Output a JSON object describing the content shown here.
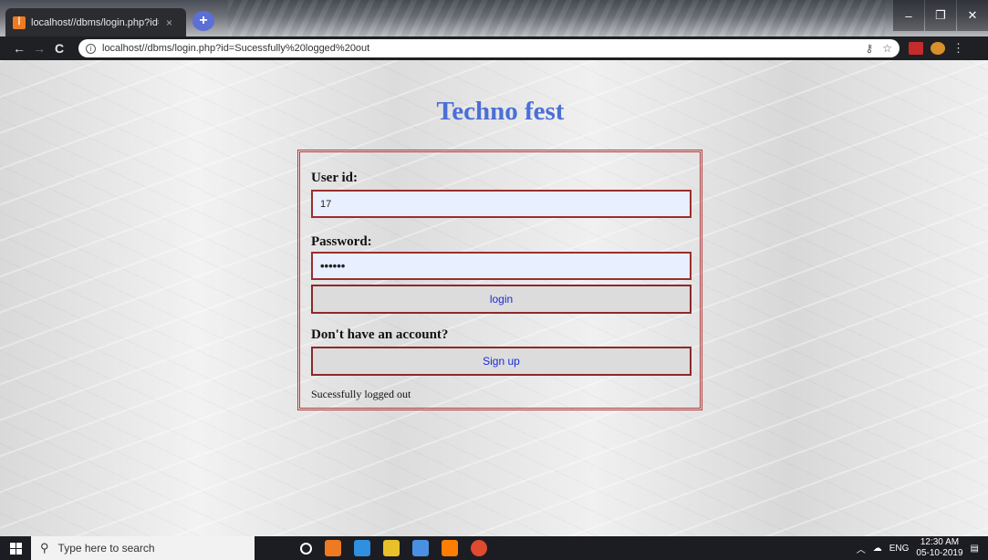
{
  "browser": {
    "tab_title": "localhost//dbms/login.php?id=S",
    "tab_close": "×",
    "new_tab": "+",
    "url": "localhost//dbms/login.php?id=Sucessfully%20logged%20out",
    "nav": {
      "back": "←",
      "forward": "→",
      "reload": "C"
    },
    "window": {
      "minimize": "–",
      "restore": "❐",
      "close": "✕"
    },
    "icons": {
      "key": "key-icon",
      "star": "star-icon",
      "menu": "⋮"
    }
  },
  "page": {
    "title": "Techno fest",
    "form": {
      "userid_label": "User id:",
      "userid_value": "17",
      "password_label": "Password:",
      "password_value": "••••••",
      "login_button": "login",
      "no_account_label": "Don't have an account?",
      "signup_button": "Sign up",
      "status_message": "Sucessfully logged out"
    }
  },
  "taskbar": {
    "search_placeholder": "Type here to search",
    "tray": {
      "language": "ENG",
      "time": "12:30 AM",
      "date": "05-10-2019"
    },
    "app_colors": [
      "#f07a21",
      "#2f8fe0",
      "#e8c12a",
      "#4a90e2",
      "#ff7d00",
      "#e04a2f"
    ]
  },
  "colors": {
    "title": "#4a6fd6",
    "box_border": "#b13a3a",
    "input_fill": "#e8efff",
    "button_text": "#1d2bd6"
  }
}
